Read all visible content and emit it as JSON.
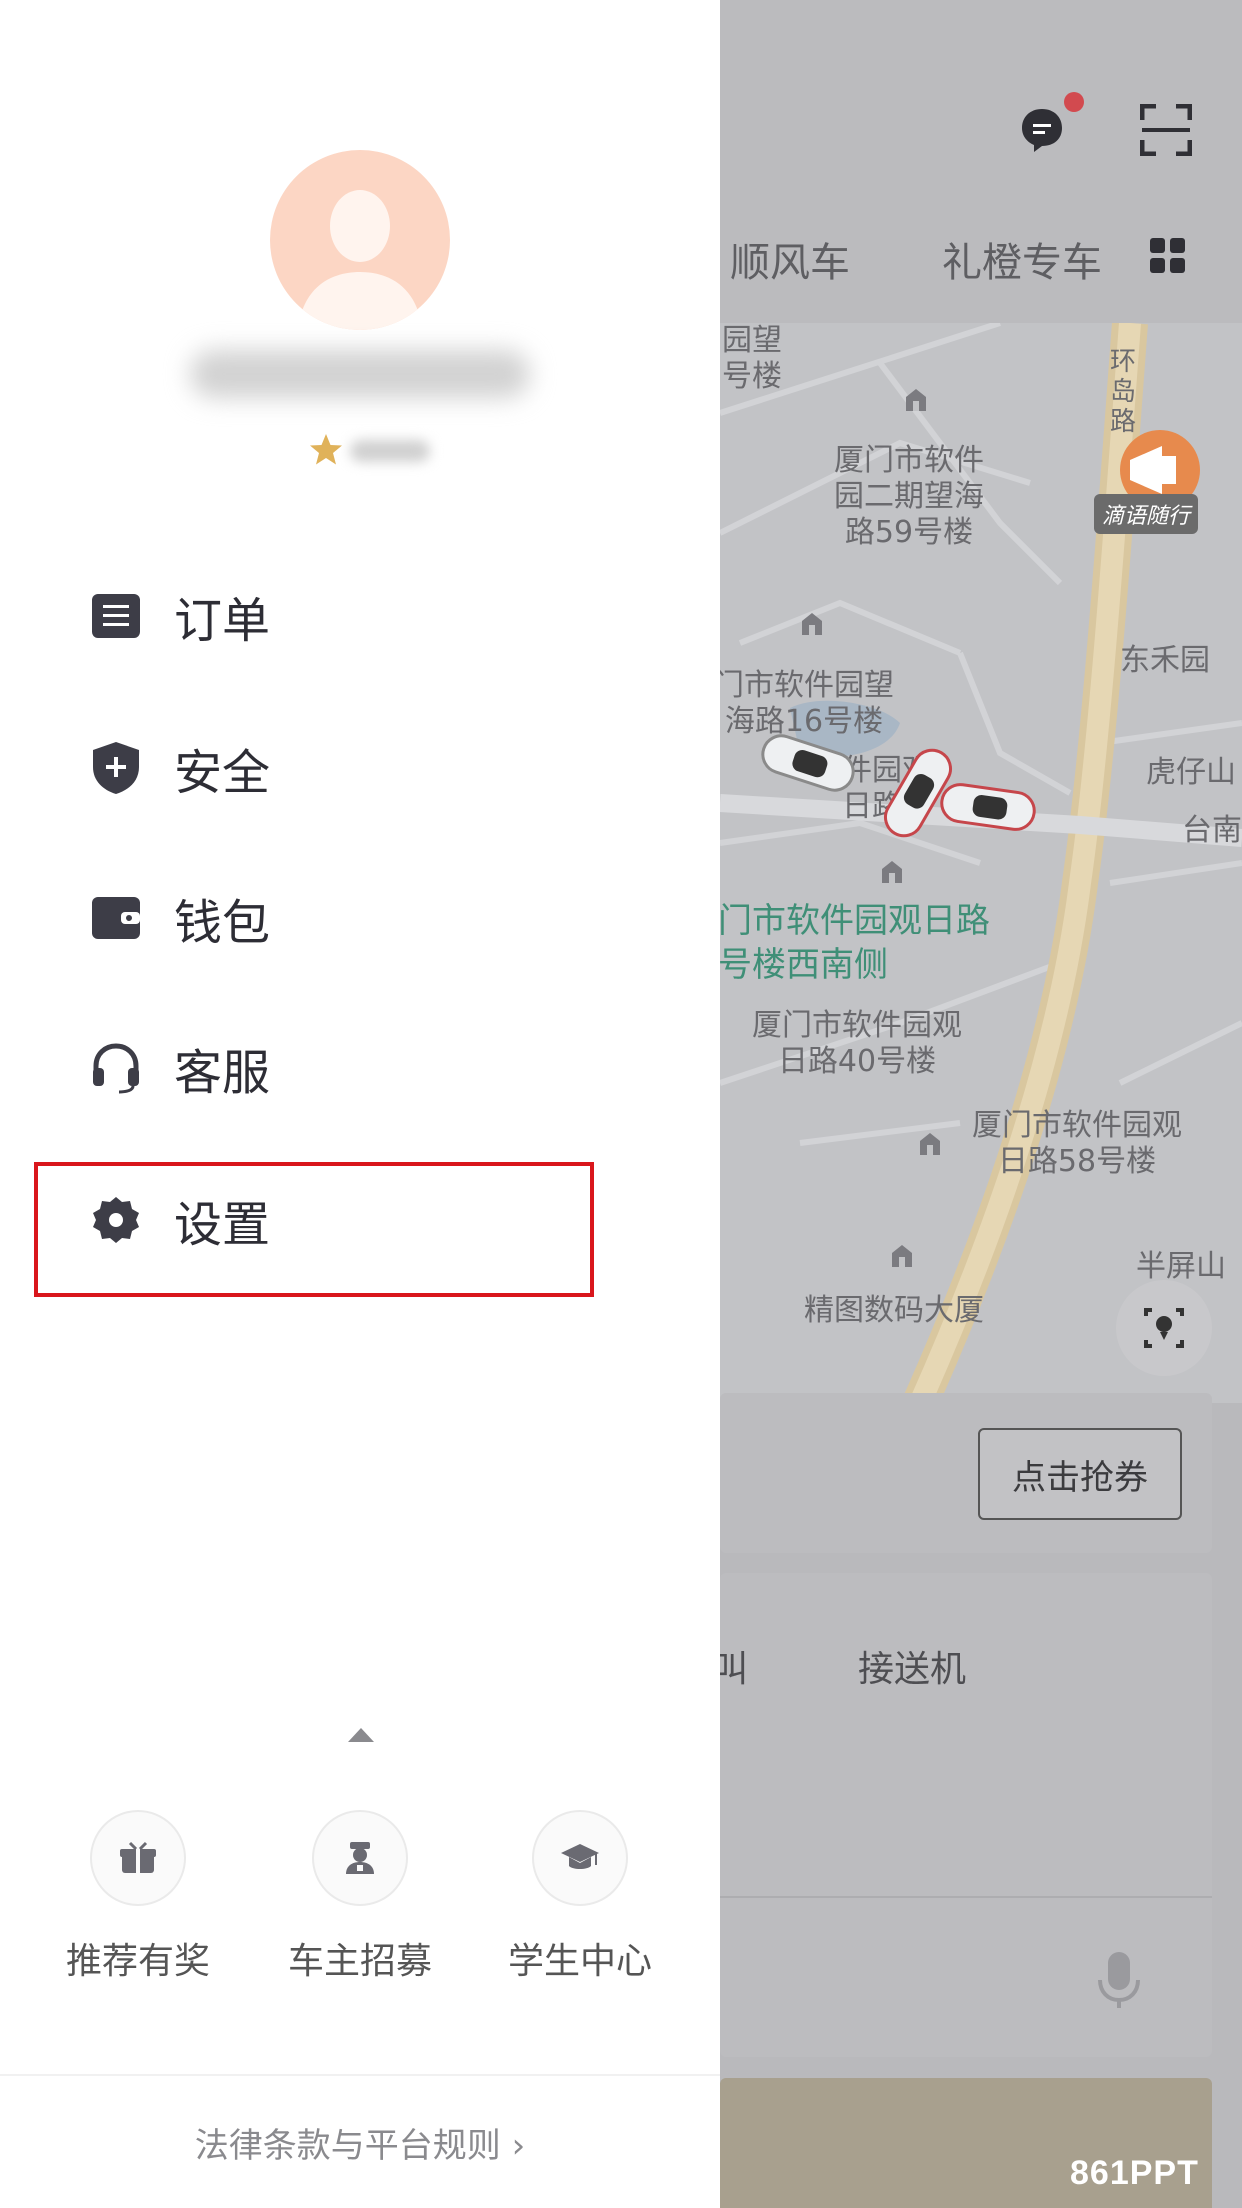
{
  "drawer": {
    "menu": [
      {
        "label": "订单",
        "icon": "order-icon"
      },
      {
        "label": "安全",
        "icon": "shield-plus-icon"
      },
      {
        "label": "钱包",
        "icon": "wallet-icon"
      },
      {
        "label": "客服",
        "icon": "headset-icon"
      },
      {
        "label": "设置",
        "icon": "gear-icon",
        "highlighted": true
      }
    ],
    "quick_links": [
      {
        "label": "推荐有奖",
        "icon": "gift-icon"
      },
      {
        "label": "车主招募",
        "icon": "driver-icon"
      },
      {
        "label": "学生中心",
        "icon": "graduation-cap-icon"
      }
    ],
    "legal_link": "法律条款与平台规则 ›",
    "highlight_color": "#d9161c"
  },
  "background": {
    "tabs": [
      "顺风车",
      "礼橙专车"
    ],
    "map_labels": [
      "园望\n号楼",
      "厦门市软件\n园二期望海\n路59号楼",
      "门市软件园望\n海路16号楼",
      "东禾园",
      "虎仔山",
      "台南",
      "软件园观\n日路",
      "门市软件园观日路\n号楼西南侧",
      "厦门市软件园观\n日路40号楼",
      "厦门市软件园观\n日路58号楼",
      "半屏山",
      "精图数码大厦",
      "环\n岛\n路"
    ],
    "promo_badge": "滴语随行",
    "coupon_button": "点击抢券",
    "service_label": "接送机",
    "service_fragment": "叫",
    "watermark": "861PPT"
  }
}
